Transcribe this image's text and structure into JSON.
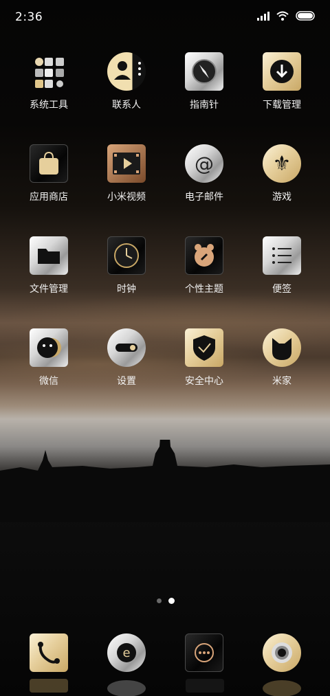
{
  "status_bar": {
    "time": "2:36"
  },
  "apps": [
    {
      "label": "系统工具",
      "icon": "folder-tools-icon"
    },
    {
      "label": "联系人",
      "icon": "contacts-icon"
    },
    {
      "label": "指南针",
      "icon": "compass-icon"
    },
    {
      "label": "下载管理",
      "icon": "download-icon"
    },
    {
      "label": "应用商店",
      "icon": "app-store-bag-icon"
    },
    {
      "label": "小米视频",
      "icon": "video-film-icon"
    },
    {
      "label": "电子邮件",
      "icon": "email-at-icon"
    },
    {
      "label": "游戏",
      "icon": "fleur-de-lis-icon"
    },
    {
      "label": "文件管理",
      "icon": "file-folder-icon"
    },
    {
      "label": "时钟",
      "icon": "clock-icon"
    },
    {
      "label": "个性主题",
      "icon": "theme-bear-icon"
    },
    {
      "label": "便签",
      "icon": "notes-list-icon"
    },
    {
      "label": "微信",
      "icon": "wechat-chat-icon"
    },
    {
      "label": "设置",
      "icon": "settings-toggle-icon"
    },
    {
      "label": "安全中心",
      "icon": "shield-icon"
    },
    {
      "label": "米家",
      "icon": "mijia-cat-icon"
    }
  ],
  "dock": [
    {
      "icon": "phone-icon"
    },
    {
      "icon": "browser-e-icon"
    },
    {
      "icon": "messages-icon"
    },
    {
      "icon": "camera-icon"
    }
  ],
  "pages": {
    "count": 2,
    "active": 2
  },
  "colors": {
    "gold": "#e6cf9c",
    "silver": "#d6d6d6",
    "black": "#0a0a0a"
  }
}
